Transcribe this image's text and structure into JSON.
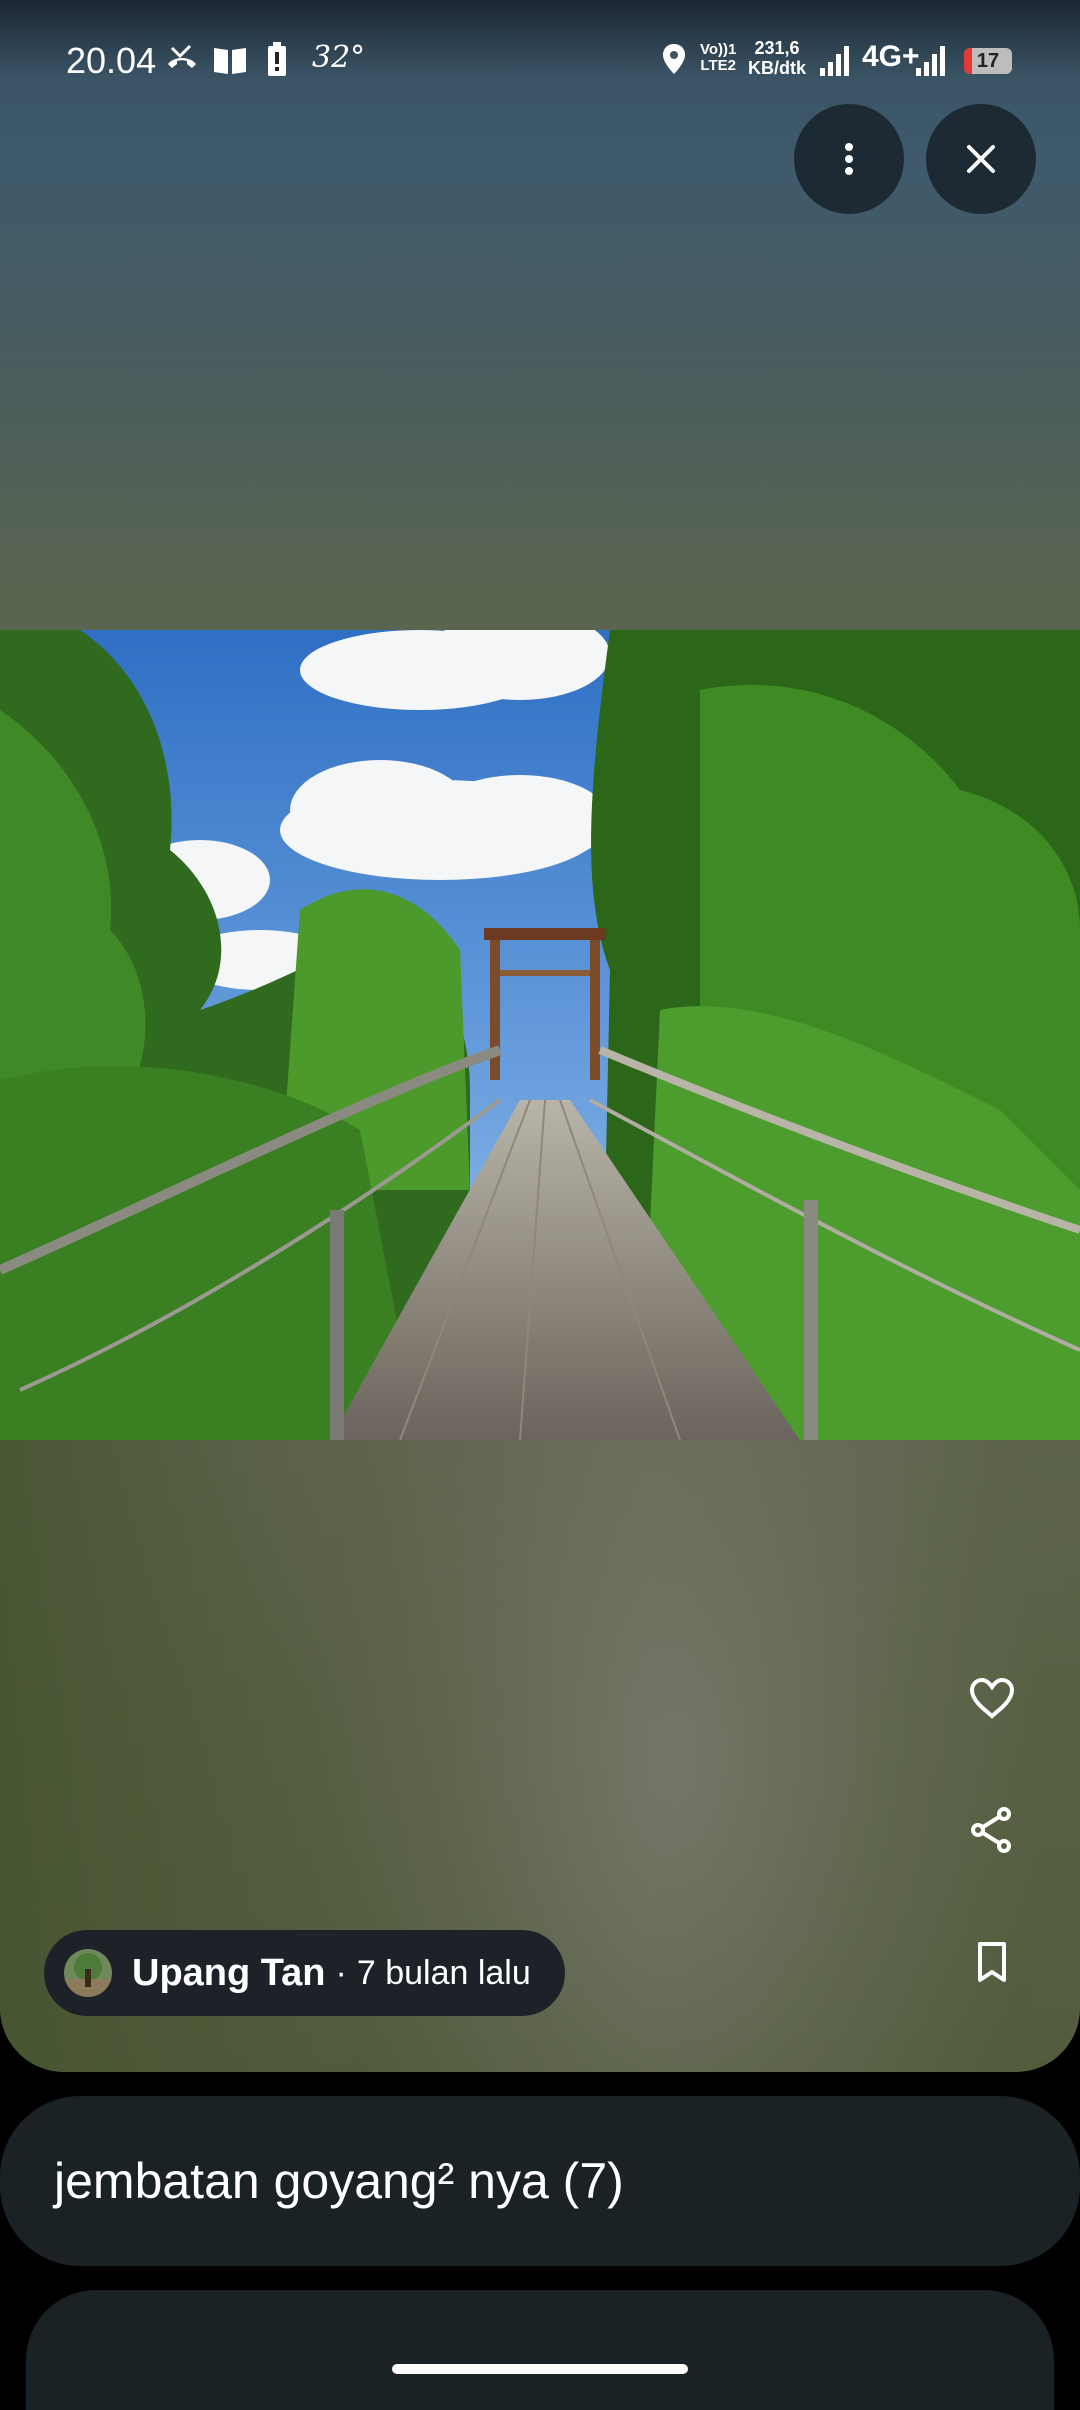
{
  "status_bar": {
    "time": "20.04",
    "temperature": "32°",
    "volte_line1": "Vo))1",
    "volte_line2": "LTE2",
    "speed_value": "231,6",
    "speed_unit": "KB/dtk",
    "network": "4G+",
    "battery": "17",
    "battery_level": 0.17,
    "icons": [
      "missed-call-icon",
      "book-icon",
      "battery-saver-icon",
      "location-icon",
      "signal-icon",
      "signal-icon-2"
    ]
  },
  "toolbar": {
    "more_icon": "more-vert-icon",
    "close_icon": "close-icon"
  },
  "photo": {
    "description_icon": "photo"
  },
  "actions": {
    "like_icon": "heart-icon",
    "share_icon": "share-icon",
    "save_icon": "bookmark-icon"
  },
  "author": {
    "name": "Upang Tan",
    "separator": "·",
    "time_ago": "7 bulan lalu"
  },
  "caption": {
    "text": "jembatan goyang² nya (7)"
  },
  "colors": {
    "card_background": "#1b2226",
    "button_background": "#1e2a33",
    "battery_low": "#e53935"
  }
}
